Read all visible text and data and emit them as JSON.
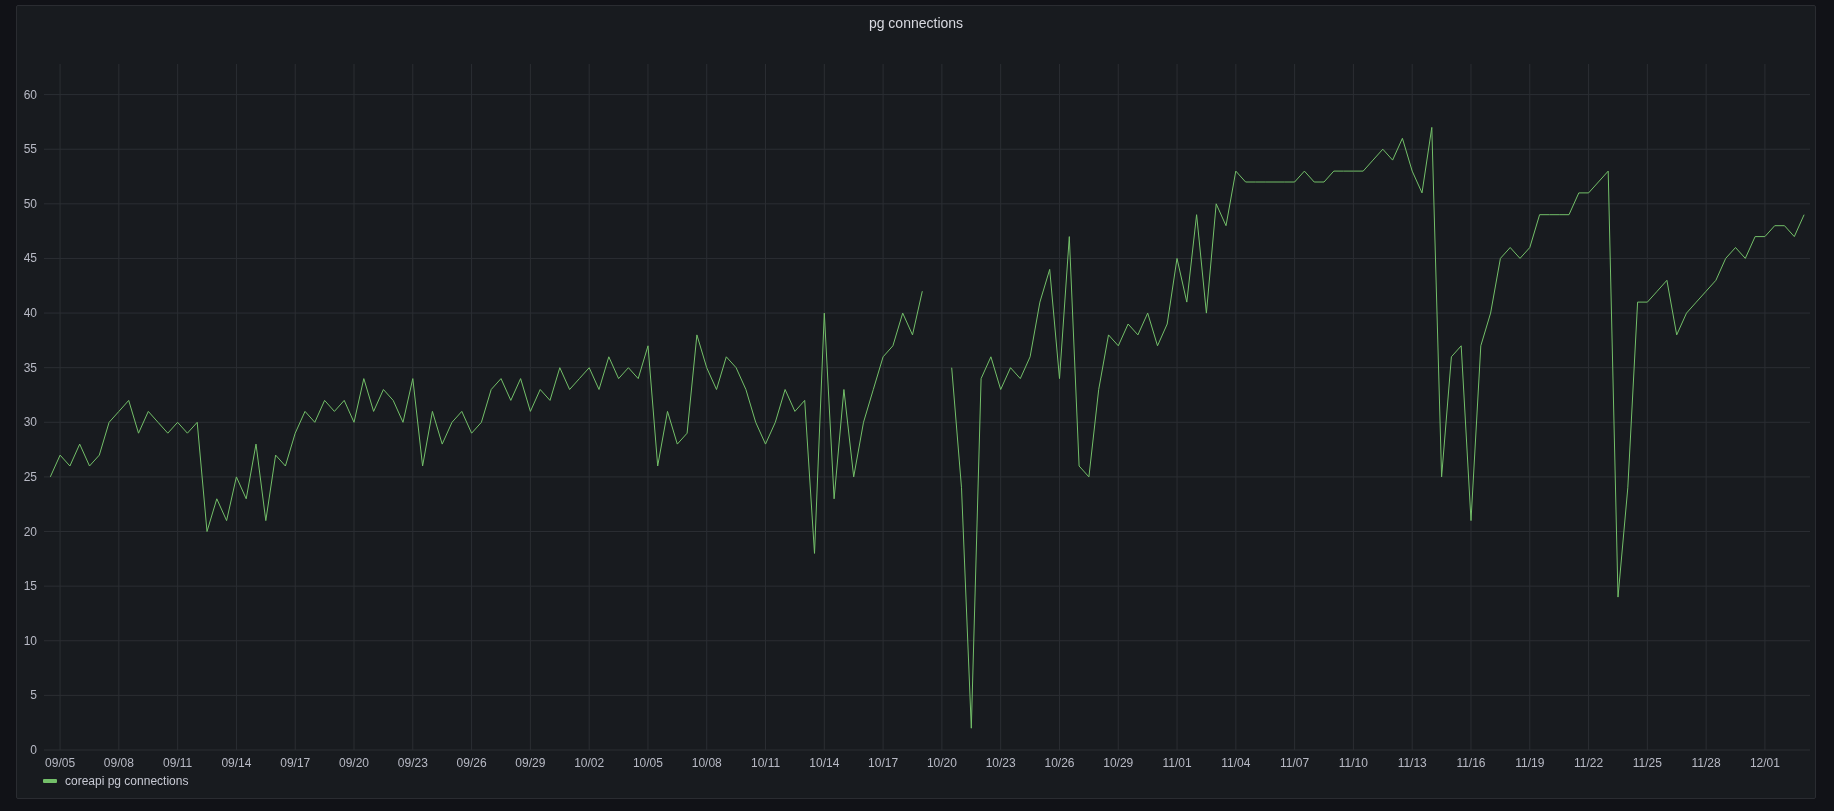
{
  "panel": {
    "title": "pg connections",
    "chart_data": {
      "type": "line",
      "grid": true,
      "ylim": [
        0,
        62.8
      ],
      "categories": [
        null,
        "09/05",
        null,
        null,
        null,
        null,
        null,
        "09/08",
        null,
        null,
        null,
        null,
        null,
        "09/11",
        null,
        null,
        null,
        null,
        null,
        "09/14",
        null,
        null,
        null,
        null,
        null,
        "09/17",
        null,
        null,
        null,
        null,
        null,
        "09/20",
        null,
        null,
        null,
        null,
        null,
        "09/23",
        null,
        null,
        null,
        null,
        null,
        "09/26",
        null,
        null,
        null,
        null,
        null,
        "09/29",
        null,
        null,
        null,
        null,
        null,
        "10/02",
        null,
        null,
        null,
        null,
        null,
        "10/05",
        null,
        null,
        null,
        null,
        null,
        "10/08",
        null,
        null,
        null,
        null,
        null,
        "10/11",
        null,
        null,
        null,
        null,
        null,
        "10/14",
        null,
        null,
        null,
        null,
        null,
        "10/17",
        null,
        null,
        null,
        null,
        null,
        "10/20",
        null,
        null,
        null,
        null,
        null,
        "10/23",
        null,
        null,
        null,
        null,
        null,
        "10/26",
        null,
        null,
        null,
        null,
        null,
        "10/29",
        null,
        null,
        null,
        null,
        null,
        "11/01",
        null,
        null,
        null,
        null,
        null,
        "11/04",
        null,
        null,
        null,
        null,
        null,
        "11/07",
        null,
        null,
        null,
        null,
        null,
        "11/10",
        null,
        null,
        null,
        null,
        null,
        "11/13",
        null,
        null,
        null,
        null,
        null,
        "11/16",
        null,
        null,
        null,
        null,
        null,
        "11/19",
        null,
        null,
        null,
        null,
        null,
        "11/22",
        null,
        null,
        null,
        null,
        null,
        "11/25",
        null,
        null,
        null,
        null,
        null,
        "11/28",
        null,
        null,
        null,
        null,
        null,
        "12/01",
        null,
        null,
        null,
        null
      ],
      "series": [
        {
          "name": "coreapi pg connections",
          "color": "#73bf69",
          "values": [
            25,
            27,
            26,
            28,
            26,
            27,
            30,
            31,
            32,
            29,
            31,
            30,
            29,
            30,
            29,
            30,
            20,
            23,
            21,
            25,
            23,
            28,
            21,
            27,
            26,
            29,
            31,
            30,
            32,
            31,
            32,
            30,
            34,
            31,
            33,
            32,
            30,
            34,
            26,
            31,
            28,
            30,
            31,
            29,
            30,
            33,
            34,
            32,
            34,
            31,
            33,
            32,
            35,
            33,
            34,
            35,
            33,
            36,
            34,
            35,
            34,
            37,
            26,
            31,
            28,
            29,
            38,
            35,
            33,
            36,
            35,
            33,
            30,
            28,
            30,
            33,
            31,
            32,
            18,
            40,
            23,
            33,
            25,
            30,
            33,
            36,
            37,
            40,
            38,
            42,
            null,
            null,
            35,
            24,
            2,
            34,
            36,
            33,
            35,
            34,
            36,
            41,
            44,
            34,
            47,
            26,
            25,
            33,
            38,
            37,
            39,
            38,
            40,
            37,
            39,
            45,
            41,
            49,
            40,
            50,
            48,
            53,
            52,
            52,
            52,
            52,
            52,
            52,
            53,
            52,
            52,
            53,
            53,
            53,
            53,
            54,
            55,
            54,
            56,
            53,
            51,
            57,
            25,
            36,
            37,
            21,
            37,
            40,
            45,
            46,
            45,
            46,
            49,
            49,
            49,
            49,
            51,
            51,
            52,
            53,
            14,
            24,
            41,
            41,
            42,
            43,
            38,
            40,
            41,
            42,
            43,
            45,
            46,
            45,
            47,
            47,
            48,
            48,
            47,
            49
          ]
        }
      ],
      "yticks": [
        0,
        5,
        10,
        15,
        20,
        25,
        30,
        35,
        40,
        45,
        50,
        55,
        60
      ]
    }
  }
}
